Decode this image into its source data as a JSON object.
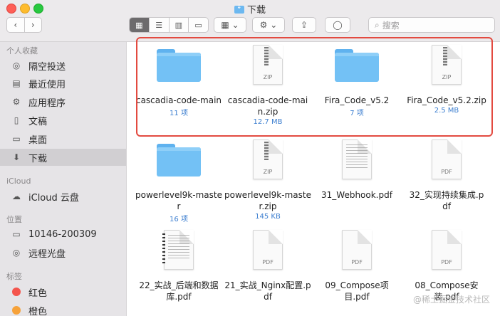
{
  "window": {
    "title": "下载"
  },
  "toolbar": {
    "back_label": "‹",
    "forward_label": "›",
    "view_icons": [
      "▦",
      "☰",
      "▥",
      "▭"
    ],
    "group_label": "▦ ⌄",
    "action_label": "⚙ ⌄",
    "share_label": "⇪",
    "tag_label": "◯",
    "search_placeholder": "搜索"
  },
  "sidebar": {
    "sections": [
      "个人收藏",
      "iCloud",
      "位置",
      "标签"
    ],
    "favorites": [
      {
        "label": "隔空投送",
        "icon": "◎"
      },
      {
        "label": "最近使用",
        "icon": "▤"
      },
      {
        "label": "应用程序",
        "icon": "⚙"
      },
      {
        "label": "文稿",
        "icon": "▯"
      },
      {
        "label": "桌面",
        "icon": "▭"
      },
      {
        "label": "下载",
        "icon": "⬇"
      }
    ],
    "icloud": [
      {
        "label": "iCloud 云盘",
        "icon": "☁"
      }
    ],
    "locations": [
      {
        "label": "10146-200309",
        "icon": "▭"
      },
      {
        "label": "远程光盘",
        "icon": "◎"
      }
    ],
    "tags": [
      {
        "label": "红色",
        "color": "#f4544c"
      },
      {
        "label": "橙色",
        "color": "#f6a23a"
      }
    ]
  },
  "files": [
    {
      "name": "cascadia-code-main",
      "meta": "11 项",
      "kind": "folder"
    },
    {
      "name": "cascadia-code-main.zip",
      "meta": "12.7 MB",
      "kind": "zip",
      "tag": "ZIP"
    },
    {
      "name": "Fira_Code_v5.2",
      "meta": "7 项",
      "kind": "folder"
    },
    {
      "name": "Fira_Code_v5.2.zip",
      "meta": "2.5 MB",
      "kind": "zip",
      "tag": "ZIP"
    },
    {
      "name": "powerlevel9k-master",
      "meta": "16 项",
      "kind": "folder"
    },
    {
      "name": "powerlevel9k-master.zip",
      "meta": "145 KB",
      "kind": "zip",
      "tag": "ZIP"
    },
    {
      "name": "31_Webhook.pdf",
      "meta": "",
      "kind": "pdf",
      "tag": ""
    },
    {
      "name": "32_实现持续集成.pdf",
      "meta": "",
      "kind": "pdf",
      "tag": "PDF"
    },
    {
      "name": "22_实战_后端和数据库.pdf",
      "meta": "",
      "kind": "pdf",
      "tag": ""
    },
    {
      "name": "21_实战_Nginx配置.pdf",
      "meta": "",
      "kind": "pdf",
      "tag": "PDF"
    },
    {
      "name": "09_Compose项目.pdf",
      "meta": "",
      "kind": "pdf",
      "tag": "PDF"
    },
    {
      "name": "08_Compose安装.pdf",
      "meta": "",
      "kind": "pdf",
      "tag": "PDF"
    }
  ],
  "watermark": "@稀土掘金技术社区",
  "accent": "#e34a40"
}
